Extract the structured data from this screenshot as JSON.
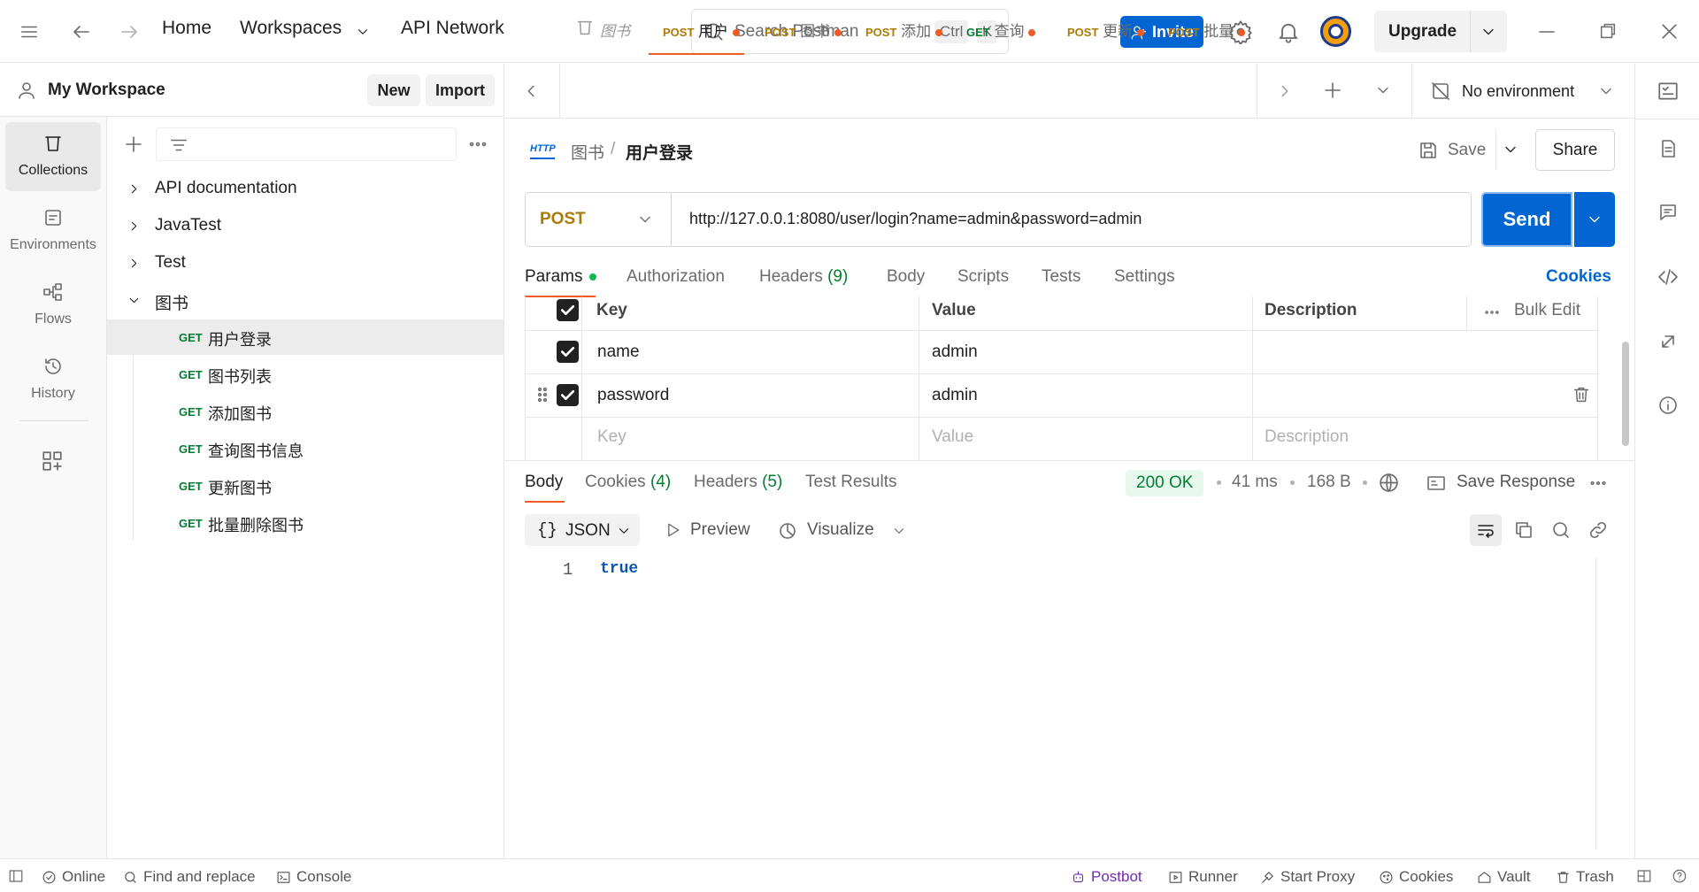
{
  "topbar": {
    "home": "Home",
    "workspaces": "Workspaces",
    "api_network": "API Network",
    "search_placeholder": "Search Postman",
    "kbd_ctrl": "Ctrl",
    "kbd_k": "K",
    "invite": "Invite",
    "upgrade": "Upgrade"
  },
  "workspace": {
    "name": "My Workspace",
    "new": "New",
    "import": "Import"
  },
  "rail": {
    "items": [
      {
        "label": "Collections"
      },
      {
        "label": "Environments"
      },
      {
        "label": "Flows"
      },
      {
        "label": "History"
      }
    ]
  },
  "tree": {
    "collections": [
      "API documentation",
      "JavaTest",
      "Test",
      "图书"
    ],
    "requests": [
      {
        "method": "GET",
        "name": "用户登录"
      },
      {
        "method": "GET",
        "name": "图书列表"
      },
      {
        "method": "GET",
        "name": "添加图书"
      },
      {
        "method": "GET",
        "name": "查询图书信息"
      },
      {
        "method": "GET",
        "name": "更新图书"
      },
      {
        "method": "GET",
        "name": "批量删除图书"
      }
    ]
  },
  "tabs": [
    {
      "method": "",
      "name": "图书"
    },
    {
      "method": "POST",
      "name": "用户"
    },
    {
      "method": "POST",
      "name": "图书"
    },
    {
      "method": "POST",
      "name": "添加"
    },
    {
      "method": "GET",
      "name": "查询"
    },
    {
      "method": "POST",
      "name": "更新"
    },
    {
      "method": "POST",
      "name": "批量"
    }
  ],
  "environment": "No environment",
  "breadcrumb": {
    "badge": "HTTP",
    "parent": "图书",
    "sep": "/",
    "current": "用户登录"
  },
  "actions": {
    "save": "Save",
    "share": "Share"
  },
  "request": {
    "method": "POST",
    "url": "http://127.0.0.1:8080/user/login?name=admin&password=admin",
    "send": "Send"
  },
  "req_tabs": {
    "params": "Params",
    "authorization": "Authorization",
    "headers": "Headers",
    "headers_count": "(9)",
    "body": "Body",
    "scripts": "Scripts",
    "tests": "Tests",
    "settings": "Settings",
    "cookies": "Cookies"
  },
  "params": {
    "headers": {
      "key": "Key",
      "value": "Value",
      "description": "Description",
      "bulk_edit": "Bulk Edit"
    },
    "rows": [
      {
        "key": "name",
        "value": "admin"
      },
      {
        "key": "password",
        "value": "admin"
      }
    ],
    "placeholders": {
      "key": "Key",
      "value": "Value",
      "description": "Description"
    }
  },
  "response": {
    "tabs": {
      "body": "Body",
      "cookies": "Cookies",
      "cookies_count": "(4)",
      "headers": "Headers",
      "headers_count": "(5)",
      "test_results": "Test Results"
    },
    "status": "200 OK",
    "time": "41 ms",
    "size": "168 B",
    "save_response": "Save Response",
    "format": "JSON",
    "preview": "Preview",
    "visualize": "Visualize",
    "line_no": "1",
    "body": "true"
  },
  "statusbar": {
    "online": "Online",
    "find_replace": "Find and replace",
    "console": "Console",
    "postbot": "Postbot",
    "runner": "Runner",
    "start_proxy": "Start Proxy",
    "cookies": "Cookies",
    "vault": "Vault",
    "trash": "Trash"
  },
  "colors": {
    "accent": "#0265d2",
    "get": "#0cbb52",
    "post": "#ad7a03",
    "unsaved_dot": "#ef5b25",
    "status_ok_bg": "#e8f8ee",
    "status_ok": "#007f31"
  }
}
